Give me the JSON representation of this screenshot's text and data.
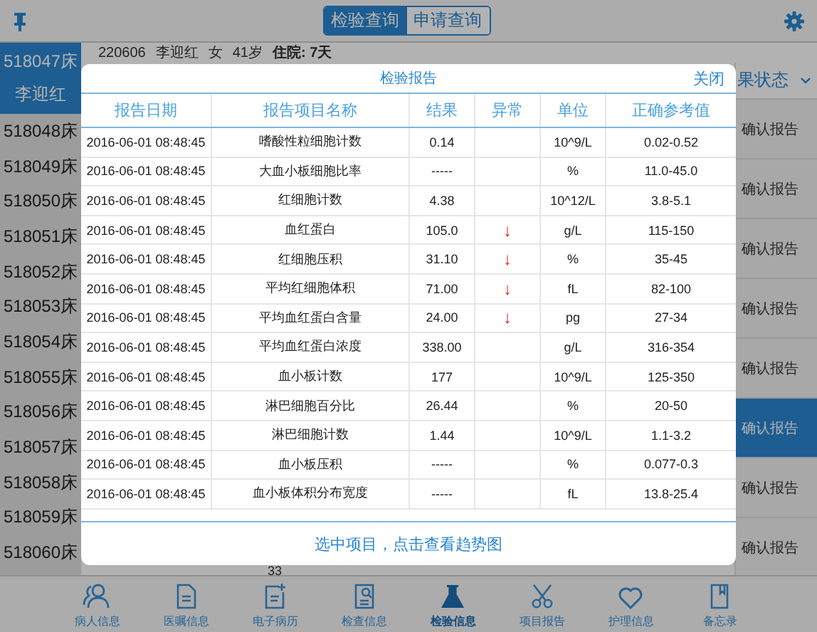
{
  "top_bar": {
    "segments": [
      {
        "label": "检验查询",
        "selected": true
      },
      {
        "label": "申请查询",
        "selected": false
      }
    ]
  },
  "beds": [
    {
      "bed": "518047床",
      "name": "李迎红",
      "selected": true
    },
    {
      "bed": "518048床",
      "selected": false
    },
    {
      "bed": "518049床",
      "selected": false
    },
    {
      "bed": "518050床",
      "selected": false
    },
    {
      "bed": "518051床",
      "selected": false
    },
    {
      "bed": "518052床",
      "selected": false
    },
    {
      "bed": "518053床",
      "selected": false
    },
    {
      "bed": "518054床",
      "selected": false
    },
    {
      "bed": "518055床",
      "selected": false
    },
    {
      "bed": "518056床",
      "selected": false
    },
    {
      "bed": "518057床",
      "selected": false
    },
    {
      "bed": "518058床",
      "selected": false
    },
    {
      "bed": "518059床",
      "selected": false
    },
    {
      "bed": "518060床",
      "selected": false
    }
  ],
  "patient_header": {
    "id": "220606",
    "name": "李迎红",
    "sex": "女",
    "age": "41岁",
    "stay": "住院: 7天"
  },
  "status_column": {
    "header": "果状态",
    "cells": [
      {
        "label": "确认报告",
        "selected": false
      },
      {
        "label": "确认报告",
        "selected": false
      },
      {
        "label": "确认报告",
        "selected": false
      },
      {
        "label": "确认报告",
        "selected": false
      },
      {
        "label": "确认报告",
        "selected": false
      },
      {
        "label": "确认报告",
        "selected": true
      },
      {
        "label": "确认报告",
        "selected": false
      },
      {
        "label": "确认报告",
        "selected": false
      }
    ]
  },
  "behind_text": "33",
  "modal": {
    "title": "检验报告",
    "close": "关闭",
    "columns": [
      "报告日期",
      "报告项目名称",
      "结果",
      "异常",
      "单位",
      "正确参考值"
    ],
    "rows": [
      {
        "date": "2016-06-01 08:48:45",
        "item": "嗜酸性粒细胞计数",
        "result": "0.14",
        "unit": "10^9/L",
        "range": "0.02-0.52"
      },
      {
        "date": "2016-06-01 08:48:45",
        "item": "大血小板细胞比率",
        "result": "-----",
        "unit": "%",
        "range": "11.0-45.0"
      },
      {
        "date": "2016-06-01 08:48:45",
        "item": "红细胞计数",
        "result": "4.38",
        "unit": "10^12/L",
        "range": "3.8-5.1"
      },
      {
        "date": "2016-06-01 08:48:45",
        "item": "血红蛋白",
        "result": "105.0",
        "abnormal": "↓",
        "unit": "g/L",
        "range": "115-150"
      },
      {
        "date": "2016-06-01 08:48:45",
        "item": "红细胞压积",
        "result": "31.10",
        "abnormal": "↓",
        "unit": "%",
        "range": "35-45"
      },
      {
        "date": "2016-06-01 08:48:45",
        "item": "平均红细胞体积",
        "result": "71.00",
        "abnormal": "↓",
        "unit": "fL",
        "range": "82-100"
      },
      {
        "date": "2016-06-01 08:48:45",
        "item": "平均血红蛋白含量",
        "result": "24.00",
        "abnormal": "↓",
        "unit": "pg",
        "range": "27-34"
      },
      {
        "date": "2016-06-01 08:48:45",
        "item": "平均血红蛋白浓度",
        "result": "338.00",
        "unit": "g/L",
        "range": "316-354"
      },
      {
        "date": "2016-06-01 08:48:45",
        "item": "血小板计数",
        "result": "177",
        "unit": "10^9/L",
        "range": "125-350"
      },
      {
        "date": "2016-06-01 08:48:45",
        "item": "淋巴细胞百分比",
        "result": "26.44",
        "unit": "%",
        "range": "20-50"
      },
      {
        "date": "2016-06-01 08:48:45",
        "item": "淋巴细胞计数",
        "result": "1.44",
        "unit": "10^9/L",
        "range": "1.1-3.2"
      },
      {
        "date": "2016-06-01 08:48:45",
        "item": "血小板压积",
        "result": "-----",
        "unit": "%",
        "range": "0.077-0.3"
      },
      {
        "date": "2016-06-01 08:48:45",
        "item": "血小板体积分布宽度",
        "result": "-----",
        "unit": "fL",
        "range": "13.8-25.4"
      }
    ],
    "footer": "选中项目，点击查看趋势图"
  },
  "tab_bar": [
    {
      "label": "病人信息",
      "kind": "people",
      "selected": false
    },
    {
      "label": "医嘱信息",
      "kind": "doc",
      "selected": false
    },
    {
      "label": "电子病历",
      "kind": "docplus",
      "selected": false
    },
    {
      "label": "检查信息",
      "kind": "docsearch",
      "selected": false
    },
    {
      "label": "检验信息",
      "kind": "flask",
      "selected": true
    },
    {
      "label": "项目报告",
      "kind": "scissors",
      "selected": false
    },
    {
      "label": "护理信息",
      "kind": "heart",
      "selected": false
    },
    {
      "label": "备忘录",
      "kind": "note",
      "selected": false
    }
  ]
}
